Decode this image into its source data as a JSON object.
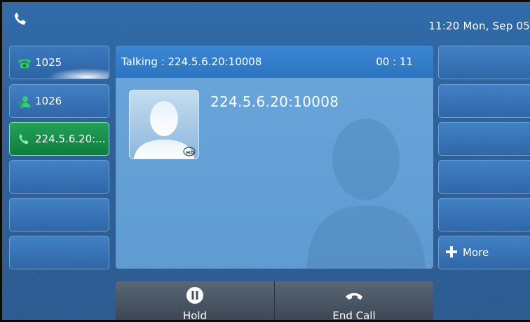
{
  "header": {
    "clock": "11:20 Mon, Sep 05"
  },
  "lines": [
    {
      "label": "1025",
      "icon": "desk-phone-icon",
      "state": "idle-glow"
    },
    {
      "label": "1026",
      "icon": "contact-phone-icon",
      "state": "idle"
    },
    {
      "label": "224.5.6.20:...",
      "icon": "handset-icon",
      "state": "active"
    }
  ],
  "call": {
    "status": "Talking : 224.5.6.20:10008",
    "timer": "00 : 11",
    "caller": "224.5.6.20:10008",
    "hd_badge": "HD"
  },
  "softkeys": {
    "more_label": "More"
  },
  "actions": {
    "hold_label": "Hold",
    "end_call_label": "End Call"
  },
  "colors": {
    "background": "#2c5f98",
    "active_line": "#1a8f4b",
    "call_header": "#3381cf",
    "action_bar": "#4a5563"
  }
}
